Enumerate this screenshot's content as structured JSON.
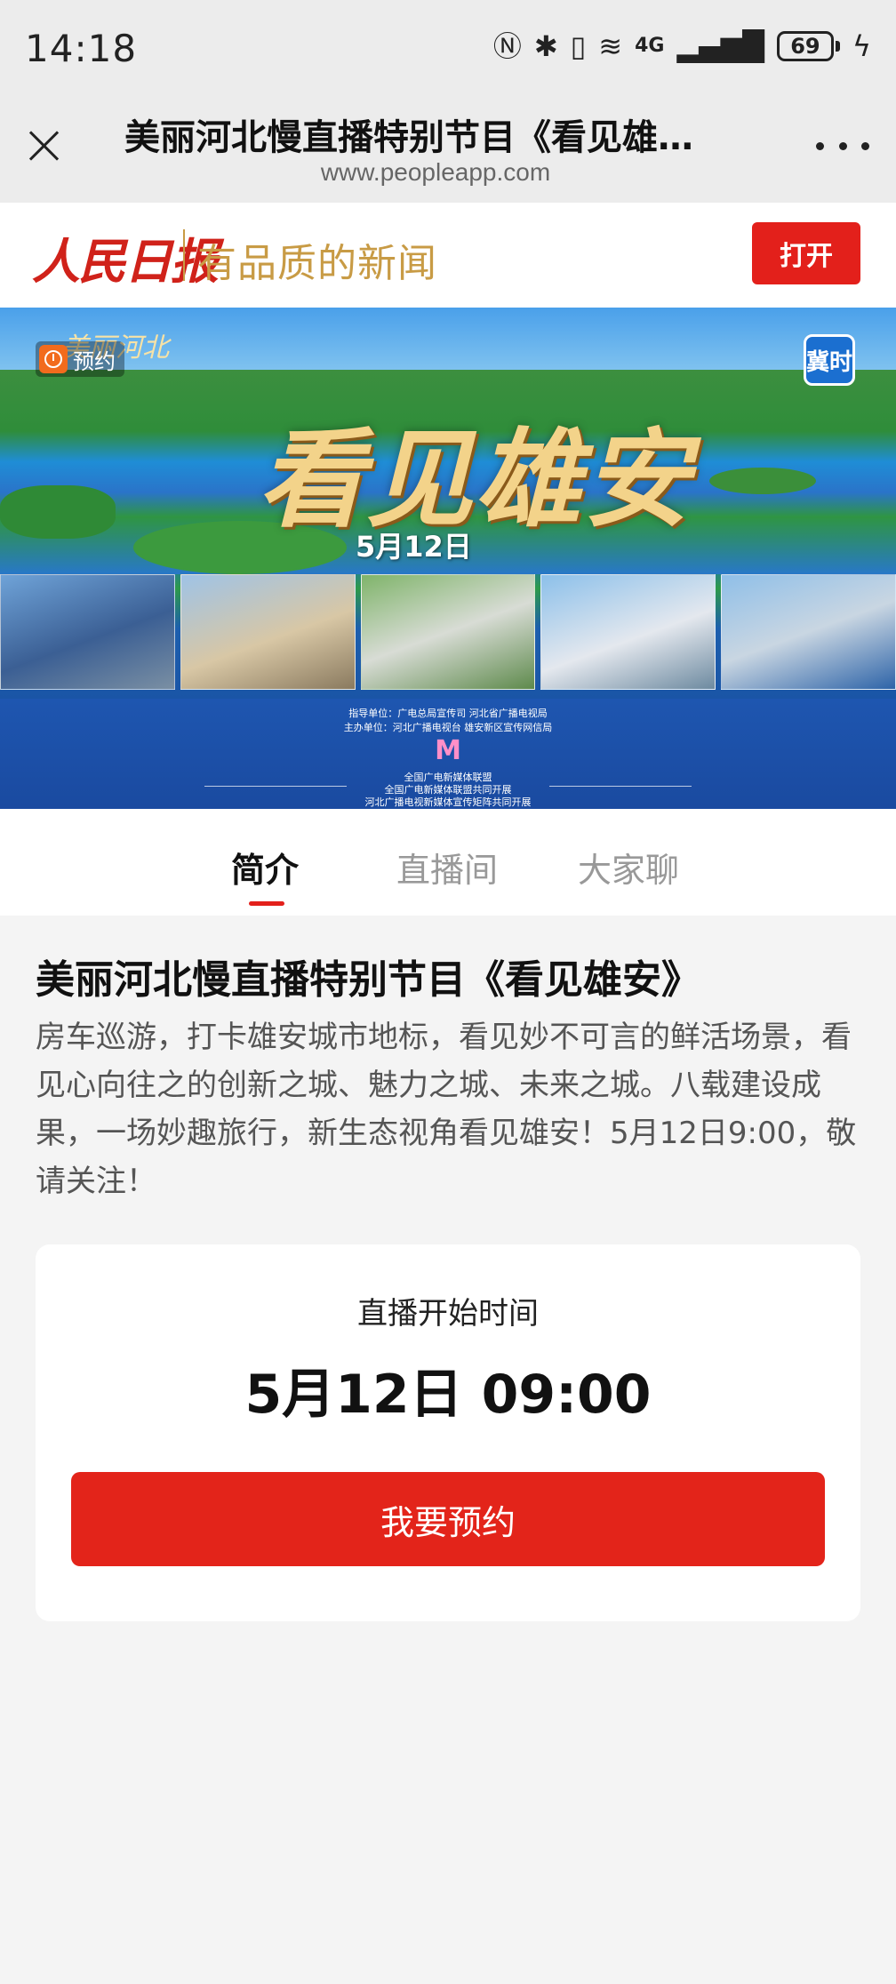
{
  "status_bar": {
    "time": "14:18",
    "network_label": "4G",
    "battery": "69",
    "icons": [
      "nfc-icon",
      "bluetooth-icon",
      "vibrate-icon",
      "wifi-icon",
      "cellular-signal-icon",
      "battery-icon",
      "charging-icon"
    ]
  },
  "browser": {
    "title": "美丽河北慢直播特别节目《看见雄…",
    "url": "www.peopleapp.com"
  },
  "app_banner": {
    "logo": "人民日报",
    "slogan": "有品质的新闻",
    "open_label": "打开"
  },
  "poster": {
    "reserve_badge": "预约",
    "show_logo": "美丽河北",
    "tv_logo": "冀时",
    "main_title": "看见雄安",
    "date": "5月12日",
    "credit_guidance": "指导单位：广电总局宣传司 河北省广播电视局",
    "credit_host": "主办单位：河北广播电视台 雄安新区宣传网信局",
    "alliance_logo": "M",
    "alliance_name": "全国广电新媒体联盟",
    "co_organizer_1": "全国广电新媒体联盟共同开展",
    "co_organizer_2": "河北广播电视新媒体宣传矩阵共同开展"
  },
  "tabs": [
    {
      "label": "简介",
      "active": true
    },
    {
      "label": "直播间",
      "active": false
    },
    {
      "label": "大家聊",
      "active": false
    }
  ],
  "program": {
    "title": "美丽河北慢直播特别节目《看见雄安》",
    "description": "房车巡游，打卡雄安城市地标，看见妙不可言的鲜活场景，看见心向往之的创新之城、魅力之城、未来之城。八载建设成果，一场妙趣旅行，新生态视角看见雄安！5月12日9:00，敬请关注！"
  },
  "schedule_card": {
    "label": "直播开始时间",
    "start_time": "5月12日 09:00",
    "button_label": "我要预约"
  },
  "colors": {
    "brand_red": "#e3201b",
    "gold": "#c89b45",
    "background": "#f4f4f4"
  }
}
